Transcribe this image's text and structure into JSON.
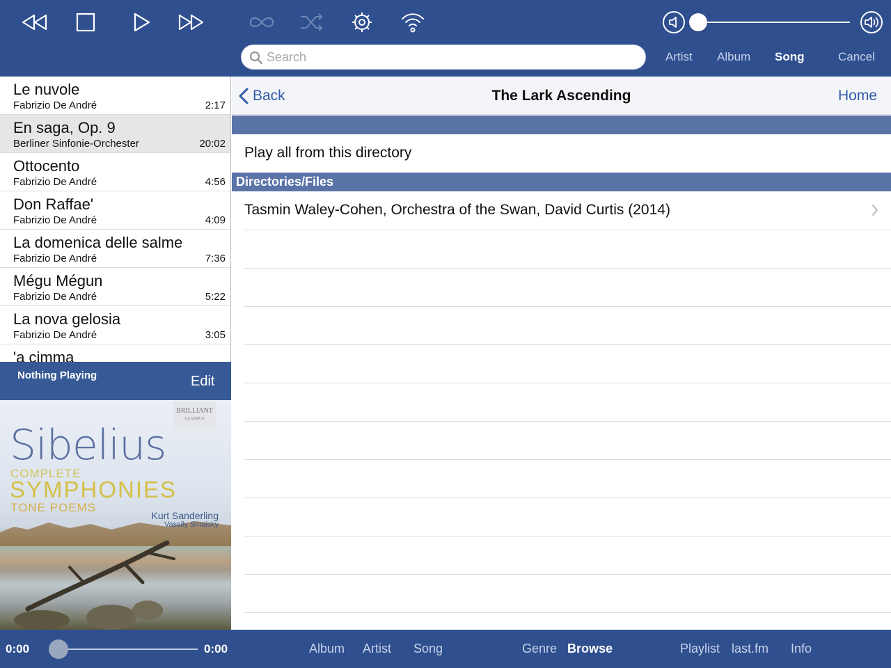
{
  "toolbar": {
    "icons": [
      "rewind-icon",
      "stop-icon",
      "play-icon",
      "fast-forward-icon",
      "repeat-icon",
      "shuffle-icon",
      "gear-icon",
      "wifi-icon"
    ],
    "volume_level": 0.0,
    "search_placeholder": "Search",
    "search_value": "",
    "scopes": [
      {
        "label": "Artist",
        "active": false
      },
      {
        "label": "Album",
        "active": false
      },
      {
        "label": "Song",
        "active": true
      }
    ],
    "cancel_label": "Cancel"
  },
  "song_list": [
    {
      "title": "Le nuvole",
      "artist": "Fabrizio De André",
      "duration": "2:17",
      "selected": false
    },
    {
      "title": "En saga, Op. 9",
      "artist": "Berliner Sinfonie-Orchester",
      "duration": "20:02",
      "selected": true
    },
    {
      "title": "Ottocento",
      "artist": "Fabrizio De André",
      "duration": "4:56",
      "selected": false
    },
    {
      "title": "Don Raffae'",
      "artist": "Fabrizio De André",
      "duration": "4:09",
      "selected": false
    },
    {
      "title": "La domenica delle salme",
      "artist": "Fabrizio De André",
      "duration": "7:36",
      "selected": false
    },
    {
      "title": "Mégu Mégun",
      "artist": "Fabrizio De André",
      "duration": "5:22",
      "selected": false
    },
    {
      "title": "La nova gelosia",
      "artist": "Fabrizio De André",
      "duration": "3:05",
      "selected": false
    },
    {
      "title": "'a cimma",
      "artist": "",
      "duration": "",
      "selected": false
    }
  ],
  "now_playing": {
    "status": "Nothing Playing",
    "edit_label": "Edit"
  },
  "album_art": {
    "label_line1": "BRILLIANT",
    "label_line2": "CLASSICS",
    "title": "Sibelius",
    "line_complete": "COMPLETE",
    "line_symphonies": "SYMPHONIES",
    "line_tone": "TONE POEMS",
    "conductor1": "Kurt Sanderling",
    "conductor2": "Vassily Sinaisky"
  },
  "detail": {
    "back_label": "Back",
    "title": "The Lark Ascending",
    "home_label": "Home",
    "play_all_label": "Play all from this directory",
    "section_header": "Directories/Files",
    "directories": [
      "Tasmin Waley-Cohen, Orchestra of the Swan, David Curtis (2014)"
    ]
  },
  "bottom": {
    "time_elapsed": "0:00",
    "time_total": "0:00",
    "progress": 0.0,
    "tabs": [
      {
        "label": "Album",
        "active": false
      },
      {
        "label": "Artist",
        "active": false
      },
      {
        "label": "Song",
        "active": false
      },
      {
        "label": "Genre",
        "active": false
      },
      {
        "label": "Browse",
        "active": true
      },
      {
        "label": "Playlist",
        "active": false
      },
      {
        "label": "last.fm",
        "active": false
      },
      {
        "label": "Info",
        "active": false
      }
    ]
  },
  "colors": {
    "bar_blue": "#2f4f8f",
    "section_blue": "#5a74a8",
    "link_blue": "#2f5aa8"
  }
}
